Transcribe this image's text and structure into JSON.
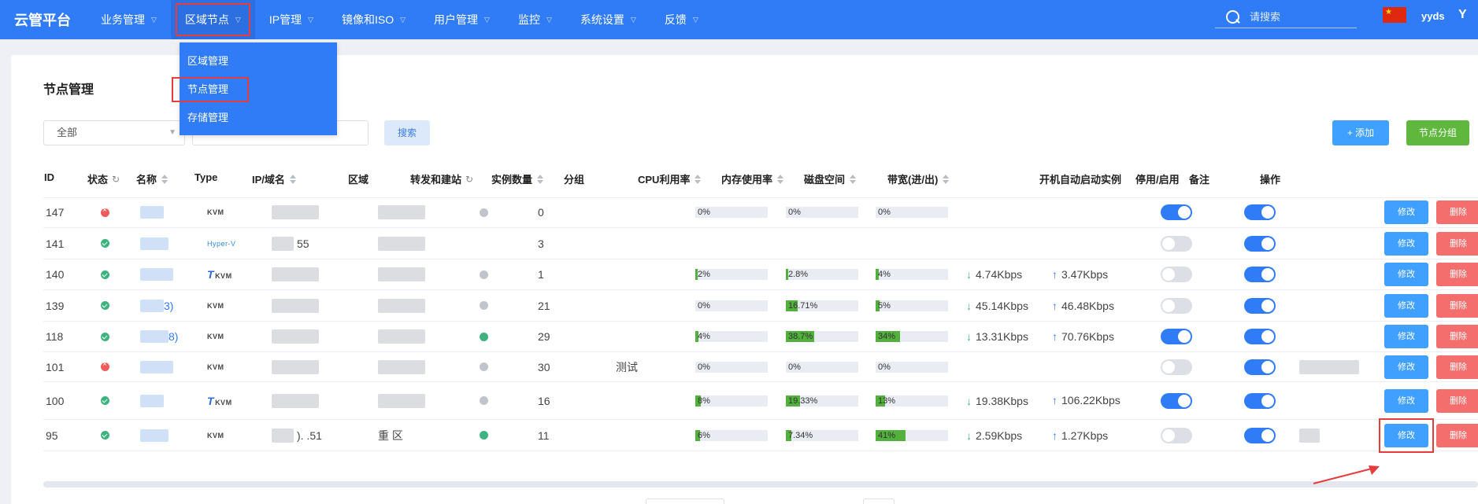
{
  "brand": "云管平台",
  "nav": [
    {
      "label": "业务管理",
      "chevron": true
    },
    {
      "label": "区域节点",
      "chevron": true,
      "active": true
    },
    {
      "label": "IP管理",
      "chevron": true
    },
    {
      "label": "镜像和ISO",
      "chevron": true
    },
    {
      "label": "用户管理",
      "chevron": true
    },
    {
      "label": "监控",
      "chevron": true
    },
    {
      "label": "系统设置",
      "chevron": true
    },
    {
      "label": "反馈",
      "chevron": true
    }
  ],
  "search_placeholder": "请搜索",
  "user": "yyds",
  "avatar": "Y",
  "dropdown": [
    "区域管理",
    "节点管理",
    "存储管理"
  ],
  "page_title": "节点管理",
  "filter": {
    "select_value": "全部",
    "input_placeholder": "",
    "search_button": "搜索"
  },
  "actions": {
    "add": "添加",
    "add_icon": "+",
    "group": "节点分组"
  },
  "columns": [
    "ID",
    "状态",
    "名称",
    "Type",
    "IP/域名",
    "区域",
    "转发和建站",
    "实例数量",
    "分组",
    "CPU利用率",
    "内存使用率",
    "磁盘空间",
    "带宽(进/出)",
    "开机自动启动实例",
    "停用/启用",
    "备注",
    "操作"
  ],
  "row_buttons": {
    "edit": "修改",
    "delete": "删除"
  },
  "rows": [
    {
      "id": "147",
      "status": "err",
      "name_suffix": "",
      "type": "KVM",
      "type_tile": false,
      "ip": "",
      "region": "",
      "forward": "grey",
      "instances": "0",
      "group": "",
      "cpu": "0%",
      "cpu_v": 0,
      "mem": "0%",
      "mem_v": 0,
      "disk": "0%",
      "disk_v": 0,
      "bw_in": "",
      "bw_out": "",
      "autostart": true,
      "enabled": true,
      "note": false
    },
    {
      "id": "141",
      "status": "ok",
      "name_suffix": "",
      "type": "Hyper-V",
      "type_tile": false,
      "ip": "55",
      "region": "",
      "forward": "",
      "instances": "3",
      "group": "",
      "cpu": "",
      "cpu_v": null,
      "mem": "",
      "mem_v": null,
      "disk": "",
      "disk_v": null,
      "bw_in": "",
      "bw_out": "",
      "autostart": false,
      "enabled": true,
      "note": false
    },
    {
      "id": "140",
      "status": "ok",
      "name_suffix": "",
      "type": "KVM",
      "type_tile": true,
      "ip": "",
      "region": "",
      "forward": "grey",
      "instances": "1",
      "group": "",
      "cpu": "2%",
      "cpu_v": 2,
      "mem": "2.8%",
      "mem_v": 2.8,
      "disk": "4%",
      "disk_v": 4,
      "bw_in": "4.74Kbps",
      "bw_out": "3.47Kbps",
      "autostart": false,
      "enabled": true,
      "note": false
    },
    {
      "id": "139",
      "status": "ok",
      "name_suffix": "3)",
      "type": "KVM",
      "type_tile": false,
      "ip": "",
      "region": "",
      "forward": "grey",
      "instances": "21",
      "group": "",
      "cpu": "0%",
      "cpu_v": 0,
      "mem": "16.71%",
      "mem_v": 16.71,
      "disk": "5%",
      "disk_v": 5,
      "bw_in": "45.14Kbps",
      "bw_out": "46.48Kbps",
      "autostart": false,
      "enabled": true,
      "note": false
    },
    {
      "id": "118",
      "status": "ok",
      "name_suffix": "8)",
      "type": "KVM",
      "type_tile": false,
      "ip": "",
      "region": "",
      "forward": "green",
      "instances": "29",
      "group": "",
      "cpu": "4%",
      "cpu_v": 4,
      "mem": "38.7%",
      "mem_v": 38.7,
      "disk": "34%",
      "disk_v": 34,
      "bw_in": "13.31Kbps",
      "bw_out": "70.76Kbps",
      "autostart": true,
      "enabled": true,
      "note": false
    },
    {
      "id": "101",
      "status": "err",
      "name_suffix": "",
      "type": "KVM",
      "type_tile": false,
      "ip": "",
      "region": "",
      "forward": "grey",
      "instances": "30",
      "group": "测试",
      "cpu": "0%",
      "cpu_v": 0,
      "mem": "0%",
      "mem_v": 0,
      "disk": "0%",
      "disk_v": 0,
      "bw_in": "",
      "bw_out": "",
      "autostart": false,
      "enabled": true,
      "note": true
    },
    {
      "id": "100",
      "status": "ok",
      "name_suffix": "",
      "type": "KVM",
      "type_tile": true,
      "ip": "",
      "region": "",
      "forward": "grey",
      "instances": "16",
      "group": "",
      "cpu": "8%",
      "cpu_v": 8,
      "mem": "19.33%",
      "mem_v": 19.33,
      "disk": "13%",
      "disk_v": 13,
      "bw_in": "19.38Kbps",
      "bw_out": "106.22Kbps",
      "autostart": true,
      "enabled": true,
      "note": false
    },
    {
      "id": "95",
      "status": "ok",
      "name_suffix": "",
      "type": "KVM",
      "type_tile": false,
      "ip": ").     .51",
      "region": "重     区",
      "forward": "green",
      "instances": "11",
      "group": "",
      "cpu": "6%",
      "cpu_v": 6,
      "mem": "7.34%",
      "mem_v": 7.34,
      "disk": "41%",
      "disk_v": 41,
      "bw_in": "2.59Kbps",
      "bw_out": "1.27Kbps",
      "autostart": false,
      "enabled": true,
      "note": true
    }
  ]
}
